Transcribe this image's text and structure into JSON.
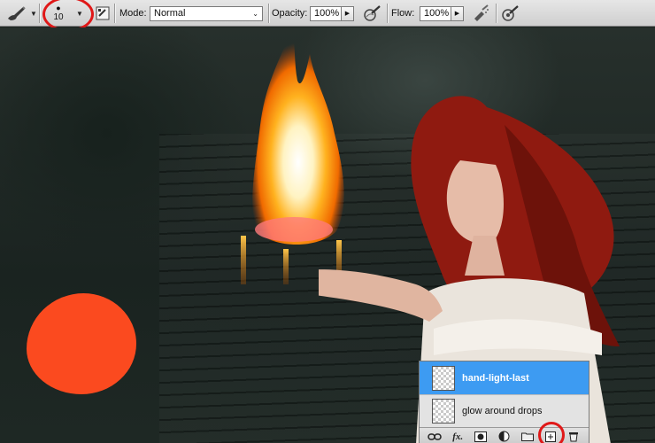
{
  "options_bar": {
    "brush_size": "10",
    "mode_label": "Mode:",
    "mode_value": "Normal",
    "opacity_label": "Opacity:",
    "opacity_value": "100%",
    "flow_label": "Flow:",
    "flow_value": "100%",
    "icons": [
      "brush-tool-icon",
      "brush-preset-icon",
      "brush-panel-toggle-icon",
      "pressure-opacity-icon",
      "airbrush-icon",
      "pressure-size-icon"
    ]
  },
  "layers_panel": {
    "layers": [
      {
        "name": "hand-light-last",
        "selected": true
      },
      {
        "name": "glow around drops",
        "selected": false
      }
    ],
    "bottom_icons": [
      "link-layers-icon",
      "fx-icon",
      "layer-mask-icon",
      "adjustment-layer-icon",
      "new-group-icon",
      "new-layer-icon",
      "trash-icon"
    ]
  },
  "colors": {
    "selection_blue": "#3d9bf2",
    "brush_blob": "#fb4a1f",
    "highlight_circle": "#e01818"
  }
}
